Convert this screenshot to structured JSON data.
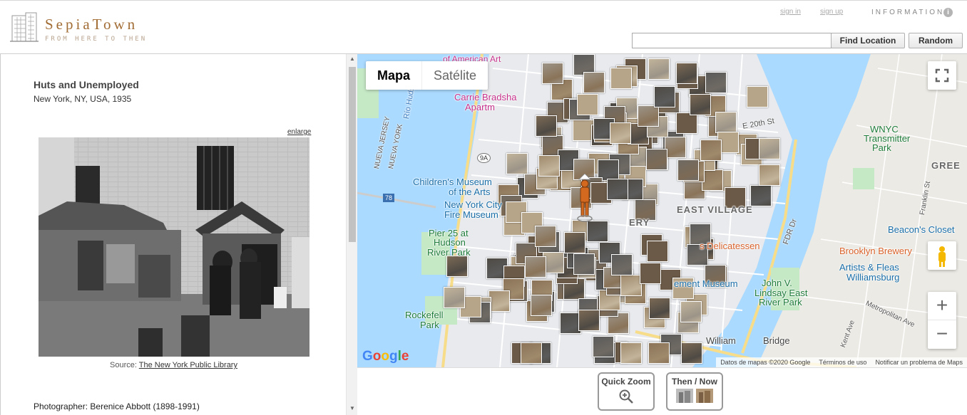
{
  "header": {
    "brand": "SepiaTown",
    "tagline": "FROM HERE TO THEN",
    "sign_in": "sign in",
    "sign_up": "sign up",
    "information": "INFORMATION",
    "info_icon": "i",
    "search_value": "",
    "find_location": "Find Location",
    "random": "Random"
  },
  "photo": {
    "title": "Huts and Unemployed",
    "location": "New York, NY, USA, 1935",
    "enlarge": "enlarge",
    "source_label": "Source:",
    "source_link": "The New York Public Library",
    "photographer": "Photographer: Berenice Abbott (1898-1991)"
  },
  "map": {
    "type_map": "Mapa",
    "type_satellite": "Satélite",
    "labels": {
      "american_art": "of American Art",
      "carrie": "Carrie Bradsha",
      "apartm": "Apartm",
      "childrens_1": "Children's Museum",
      "childrens_2": "of the Arts",
      "nycity_1": "New York City",
      "nycity_2": "Fire Museum",
      "pier_1": "Pier 25 at",
      "pier_2": "Hudson",
      "pier_3": "River Park",
      "east_village": "EAST VILLAGE",
      "ery": "ERY",
      "delicatessen": "s Delicatessen",
      "ement_museum": "ement Museum",
      "lindsay_1": "John V.",
      "lindsay_2": "Lindsay East",
      "lindsay_3": "River Park",
      "rockefeller_1": "Rockefell",
      "rockefeller_2": "Park",
      "williamsburg_bridge": "William",
      "bridge": "Bridge",
      "wnyc_1": "WNYC",
      "wnyc_2": "Transmitter",
      "wnyc_3": "Park",
      "greenpoint": "GREE",
      "beacons": "Beacon's Closet",
      "brooklyn_brewery": "Brooklyn Brewery",
      "artists_1": "Artists & Fleas",
      "artists_2": "Williamsburg",
      "nueva_jersey": "NUEVA JERSEY",
      "nueva_york": "NUEVA YORK",
      "rio_hudson": "Río Hudson",
      "e20th": "E 20th St",
      "fdr": "FDR Dr",
      "metropolitan": "Metropolitan Ave",
      "kent": "Kent Ave",
      "franklin": "Franklin St",
      "route_78": "78",
      "route_9a": "9A"
    },
    "google": "Google",
    "attribution_data": "Datos de mapas ©2020 Google",
    "attribution_terms": "Términos de uso",
    "attribution_report": "Notificar un problema de Maps"
  },
  "tools": {
    "quick_zoom": "Quick Zoom",
    "then_now": "Then / Now"
  },
  "colors": {
    "brand": "#a26d35",
    "water": "#aadaff",
    "park": "#c5e8c5",
    "land": "#e8eaed",
    "pegman": "#d2691e"
  }
}
